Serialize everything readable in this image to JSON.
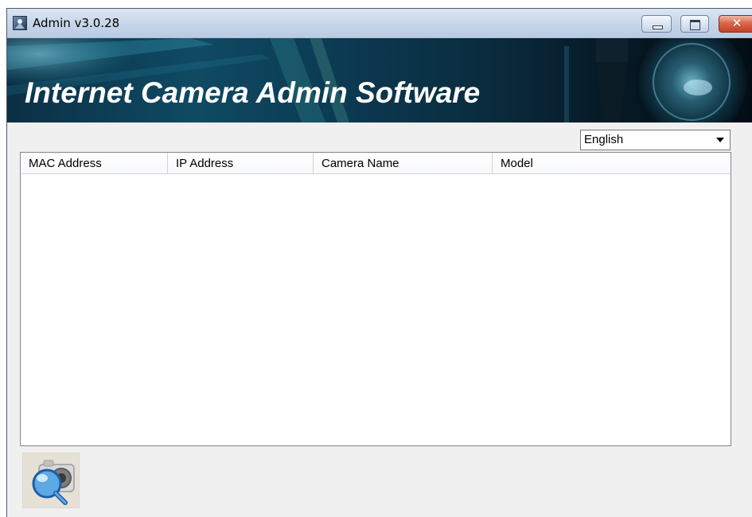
{
  "window": {
    "title": "Admin v3.0.28",
    "controls": {
      "minimize_icon": "minimize-icon",
      "maximize_icon": "maximize-icon",
      "close_icon": "close-icon",
      "close_glyph": "✕"
    }
  },
  "banner": {
    "title": "Internet Camera Admin Software"
  },
  "language": {
    "selected": "English"
  },
  "camera_list": {
    "columns": [
      "MAC Address",
      "IP Address",
      "Camera Name",
      "Model"
    ],
    "rows": []
  },
  "toolbar": {
    "search_icon": "camera-search-icon"
  },
  "colors": {
    "titlebar": "#c9d8ea",
    "banner_dark": "#0a2b3d",
    "banner_accent": "#0f4a63",
    "window_bg": "#f0f0f0",
    "close_button": "#c0422a"
  }
}
